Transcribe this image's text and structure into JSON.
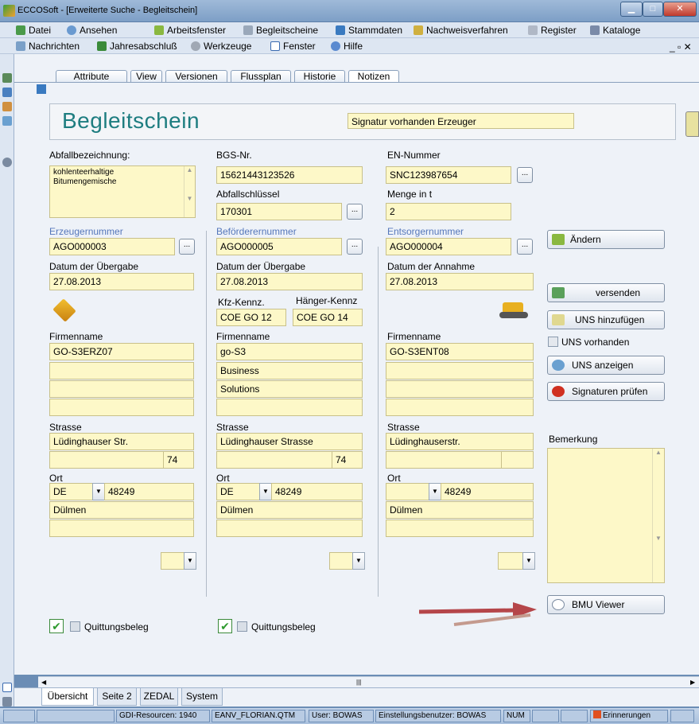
{
  "window": {
    "title": "ECCOSoft - [Erweiterte Suche - Begleitschein]"
  },
  "menu": {
    "row1": [
      "Datei",
      "Ansehen",
      "Arbeitsfenster",
      "Begleitscheine",
      "Stammdaten",
      "Nachweisverfahren",
      "Register",
      "Kataloge"
    ],
    "row2": [
      "Nachrichten",
      "Jahresabschluß",
      "Werkzeuge",
      "Fenster",
      "Hilfe"
    ]
  },
  "tabs": [
    "Attribute",
    "View",
    "Versionen",
    "Flussplan",
    "Historie",
    "Notizen"
  ],
  "header": {
    "title": "Begleitschein",
    "signature": "Signatur vorhanden Erzeuger"
  },
  "col1": {
    "abfall_label": "Abfallbezeichnung:",
    "abfall_line1": "kohlenteerhaltige",
    "abfall_line2": "Bitumengemische",
    "erzeuger_label": "Erzeugernummer",
    "erzeuger": "AGO000003",
    "datum_label": "Datum der Übergabe",
    "datum": "27.08.2013",
    "firma_label": "Firmenname",
    "firma1": "GO-S3ERZ07",
    "strasse_label": "Strasse",
    "strasse": "Lüdinghauser Str.",
    "hausnr": "74",
    "ort_label": "Ort",
    "land": "DE",
    "plz": "48249",
    "ort": "Dülmen",
    "quittung": "Quittungsbeleg"
  },
  "col2": {
    "bgs_label": "BGS-Nr.",
    "bgs": "15621443123526",
    "schluessel_label": "Abfallschlüssel",
    "schluessel": "170301",
    "befoerderer_label": "Beförderernummer",
    "befoerderer": "AGO000005",
    "datum_label": "Datum der Übergabe",
    "datum": "27.08.2013",
    "kfz_label": "Kfz-Kennz.",
    "kfz": "COE GO 12",
    "haenger_label": "Hänger-Kennz",
    "haenger": "COE GO 14",
    "firma_label": "Firmenname",
    "firma1": "go-S3",
    "firma2": "Business",
    "firma3": "Solutions",
    "strasse_label": "Strasse",
    "strasse": "Lüdinghauser Strasse",
    "hausnr": "74",
    "ort_label": "Ort",
    "land": "DE",
    "plz": "48249",
    "ort": "Dülmen",
    "quittung": "Quittungsbeleg"
  },
  "col3": {
    "en_label": "EN-Nummer",
    "en": "SNC123987654",
    "menge_label": "Menge in t",
    "menge": "2",
    "entsorger_label": "Entsorgernummer",
    "entsorger": "AGO000004",
    "datum_label": "Datum der Annahme",
    "datum": "27.08.2013",
    "firma_label": "Firmenname",
    "firma1": "GO-S3ENT08",
    "strasse_label": "Strasse",
    "strasse": "Lüdinghauserstr.",
    "ort_label": "Ort",
    "plz": "48249",
    "ort": "Dülmen"
  },
  "actions": {
    "aendern": "Ändern",
    "versenden": "versenden",
    "uns_add": "UNS hinzufügen",
    "uns_vorhanden": "UNS vorhanden",
    "uns_show": "UNS anzeigen",
    "sig_check": "Signaturen prüfen",
    "bemerkung_label": "Bemerkung",
    "bmu": "BMU Viewer"
  },
  "bottom_tabs": [
    "Übersicht",
    "Seite 2",
    "ZEDAL",
    "System"
  ],
  "status": {
    "gdi": "GDI-Resourcen: 1940",
    "file": "EANV_FLORIAN.QTM",
    "user": "User: BOWAS",
    "settings": "Einstellungsbenutzer: BOWAS",
    "num": "NUM",
    "reminders": "Erinnerungen"
  },
  "colors": {
    "title_teal": "#1e7d80",
    "field_yellow": "#fdf8c8",
    "label_blue": "#5577bb",
    "arrow_red": "#b5464a"
  }
}
